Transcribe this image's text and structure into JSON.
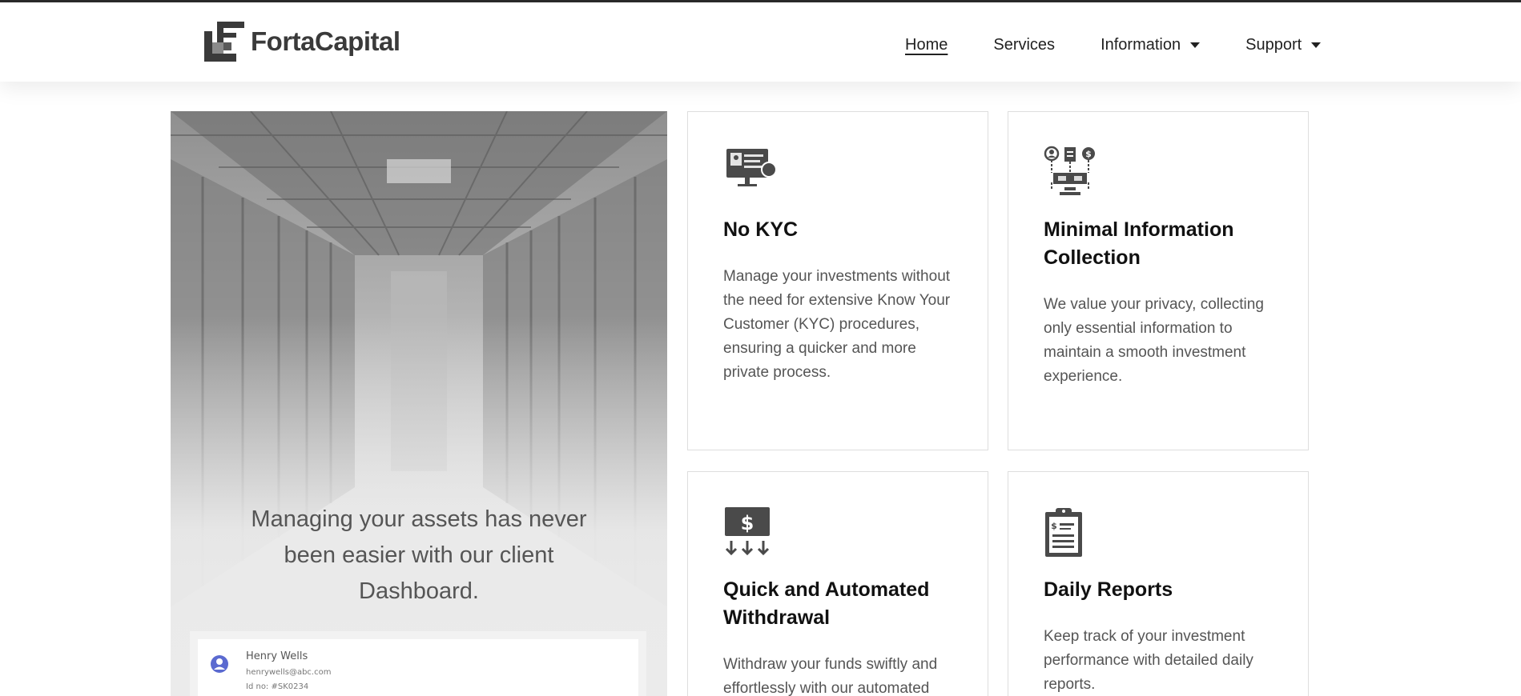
{
  "header": {
    "logo_text": "FortaCapital",
    "nav": [
      {
        "label": "Home",
        "dropdown": false,
        "active": true
      },
      {
        "label": "Services",
        "dropdown": false,
        "active": false
      },
      {
        "label": "Information",
        "dropdown": true,
        "active": false
      },
      {
        "label": "Support",
        "dropdown": true,
        "active": false
      }
    ]
  },
  "hero": {
    "text": "Managing your assets has never been easier with our client Dashboard.",
    "dashboard": {
      "name": "Henry Wells",
      "email": "henrywells@abc.com",
      "id": "Id no: #SK0234"
    }
  },
  "features": [
    {
      "icon": "monitor-id-icon",
      "title": "No KYC",
      "description": "Manage your investments without the need for extensive Know Your Customer (KYC) procedures, ensuring a quicker and more private process."
    },
    {
      "icon": "info-network-icon",
      "title": "Minimal Information Collection",
      "description": "We value your privacy, collecting only essential information to maintain a smooth investment experience."
    },
    {
      "icon": "dollar-withdraw-icon",
      "title": "Quick and Automated Withdrawal",
      "description": "Withdraw your funds swiftly and effortlessly with our automated"
    },
    {
      "icon": "clipboard-report-icon",
      "title": "Daily Reports",
      "description": "Keep track of your investment performance with detailed daily reports."
    }
  ],
  "colors": {
    "icon": "#4a4a4a",
    "avatar": "#5b6ad0",
    "border": "#dedede"
  }
}
